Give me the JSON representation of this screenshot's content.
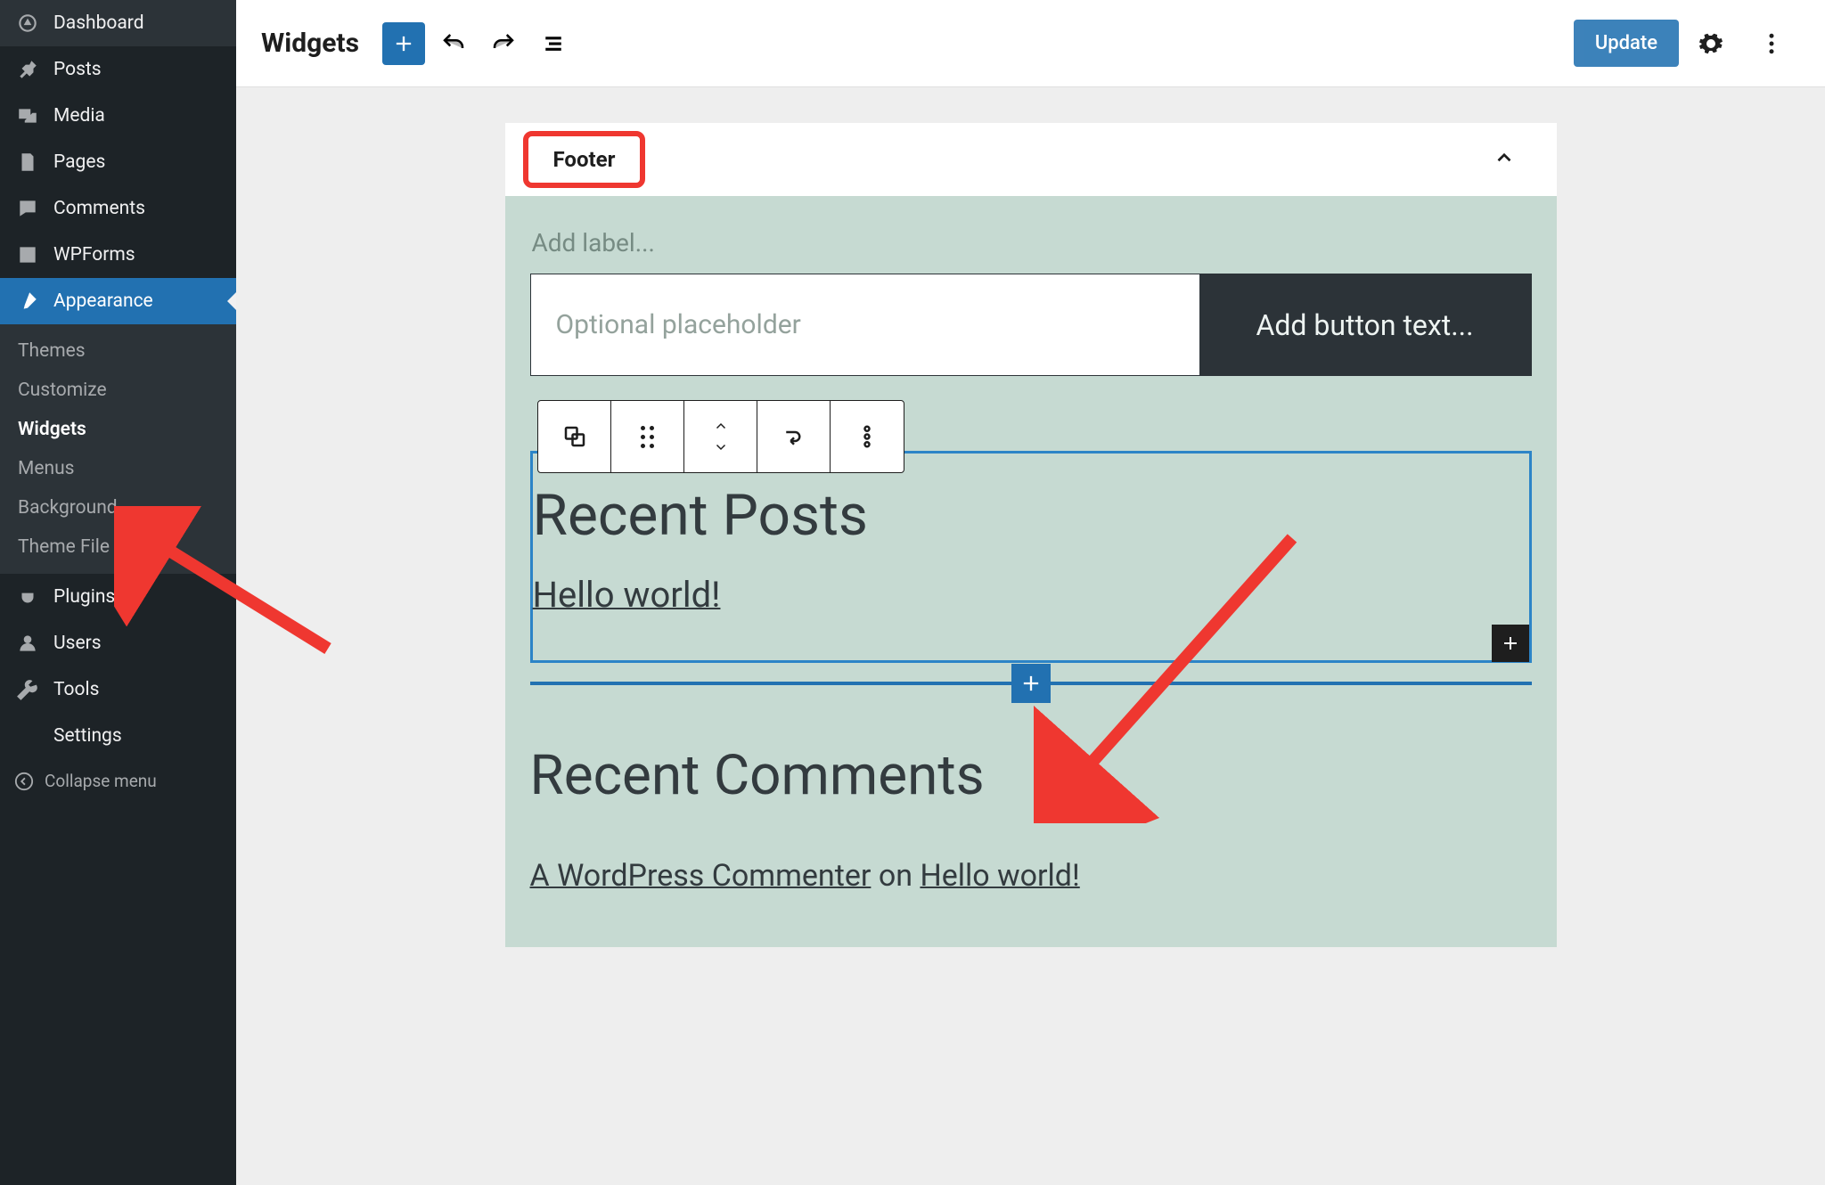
{
  "sidebar": {
    "items": [
      {
        "label": "Dashboard"
      },
      {
        "label": "Posts"
      },
      {
        "label": "Media"
      },
      {
        "label": "Pages"
      },
      {
        "label": "Comments"
      },
      {
        "label": "WPForms"
      },
      {
        "label": "Appearance"
      },
      {
        "label": "Plugins"
      },
      {
        "label": "Users"
      },
      {
        "label": "Tools"
      },
      {
        "label": "Settings"
      }
    ],
    "submenu": [
      {
        "label": "Themes"
      },
      {
        "label": "Customize"
      },
      {
        "label": "Widgets"
      },
      {
        "label": "Menus"
      },
      {
        "label": "Background"
      },
      {
        "label": "Theme File Editor"
      }
    ],
    "collapse": "Collapse menu"
  },
  "topbar": {
    "title": "Widgets",
    "update": "Update"
  },
  "canvas": {
    "area_title": "Footer",
    "add_label": "Add label...",
    "search_placeholder": "Optional placeholder",
    "button_placeholder": "Add button text...",
    "recent_posts_title": "Recent Posts",
    "recent_post_link": "Hello world!",
    "recent_comments_title": "Recent Comments",
    "comment_author": "A WordPress Commenter",
    "comment_on": " on ",
    "comment_post": "Hello world!"
  }
}
